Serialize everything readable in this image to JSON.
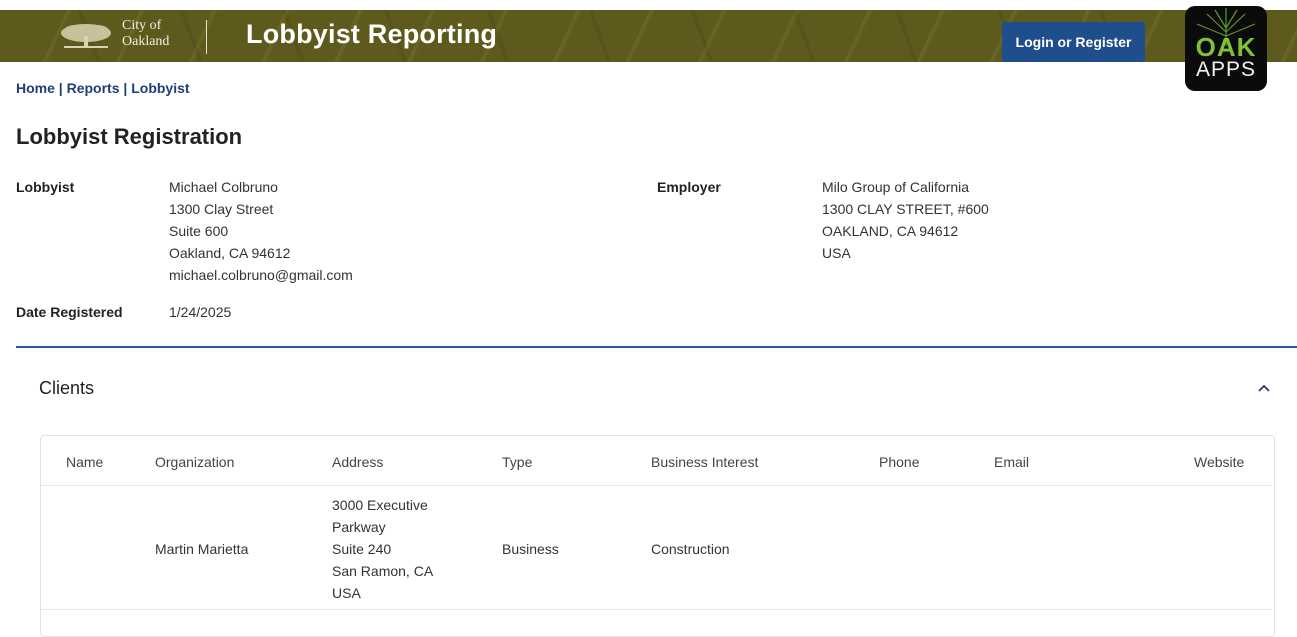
{
  "header": {
    "city_line1": "City of",
    "city_line2": "Oakland",
    "app_title": "Lobbyist Reporting",
    "login_label": "Login or Register",
    "oak_apps_top": "OAK",
    "oak_apps_bottom": "APPS",
    "brand_color": "#5e5a1e",
    "button_color": "#1f4e8c"
  },
  "breadcrumb": {
    "items": [
      "Home",
      "Reports",
      "Lobbyist"
    ],
    "separator": "|"
  },
  "page": {
    "title": "Lobbyist Registration"
  },
  "lobbyist": {
    "label": "Lobbyist",
    "lines": [
      "Michael Colbruno",
      "1300 Clay Street",
      "Suite 600",
      "Oakland, CA 94612",
      "michael.colbruno@gmail.com"
    ]
  },
  "employer": {
    "label": "Employer",
    "lines": [
      "Milo Group of California",
      "1300 CLAY STREET, #600",
      "OAKLAND, CA 94612",
      "USA"
    ]
  },
  "date_registered": {
    "label": "Date Registered",
    "value": "1/24/2025"
  },
  "clients": {
    "title": "Clients",
    "columns": [
      "Name",
      "Organization",
      "Address",
      "Type",
      "Business Interest",
      "Phone",
      "Email",
      "Website"
    ],
    "rows": [
      {
        "name": "",
        "organization": "Martin Marietta",
        "address_lines": [
          "3000 Executive",
          "Parkway",
          "Suite 240",
          "San Ramon, CA",
          "USA"
        ],
        "type": "Business",
        "business_interest": "Construction",
        "phone": "",
        "email": "",
        "website": ""
      }
    ],
    "accent_color": "#2c5aa0"
  }
}
